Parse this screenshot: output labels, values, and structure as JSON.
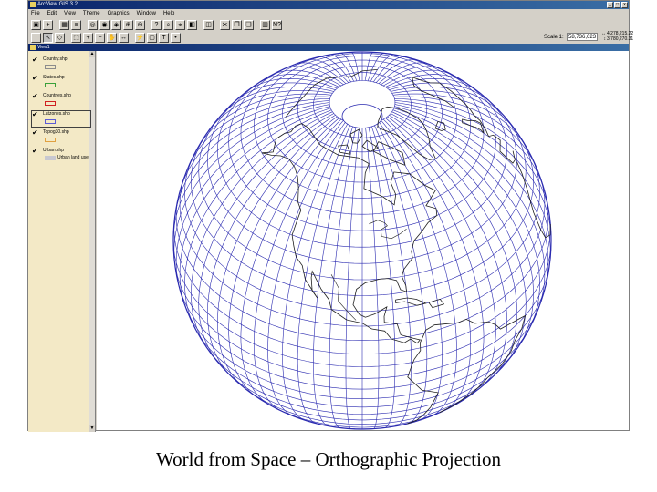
{
  "window": {
    "title": "ArcView GIS 3.2",
    "controls": [
      "_",
      "□",
      "x"
    ]
  },
  "menu": [
    "File",
    "Edit",
    "View",
    "Theme",
    "Graphics",
    "Window",
    "Help"
  ],
  "toolbar": {
    "row1_icons": [
      "save-icon",
      "add-theme-icon",
      "table-icon",
      "legend-icon",
      "zoom-full-icon",
      "zoom-active-icon",
      "zoom-selected-icon",
      "zoom-in-icon",
      "zoom-out-icon",
      "query-icon",
      "find-icon",
      "locate-icon",
      "select-by-theme-icon",
      "clear-selection-icon",
      "cut-icon",
      "copy-icon",
      "paste-icon",
      "chart-icon",
      "help-icon"
    ],
    "row2_icons": [
      "identify-icon",
      "pointer-icon",
      "vertex-icon",
      "select-icon",
      "zoom-in-tool-icon",
      "zoom-out-tool-icon",
      "pan-icon",
      "measure-icon",
      "hotlink-icon",
      "area-icon",
      "text-icon",
      "draw-icon"
    ],
    "scale_label": "Scale 1:",
    "scale_value": "58,736,623",
    "coords": [
      "4,278,215.22",
      "3,780,270.31"
    ]
  },
  "view": {
    "title": "View1",
    "layers": [
      {
        "name": "Country.shp",
        "color": "#8c8c8c",
        "active": false,
        "legend": ""
      },
      {
        "name": "States.shp",
        "color": "#3aa03a",
        "active": false,
        "legend": ""
      },
      {
        "name": "Countries.shp",
        "color": "#d02020",
        "active": false,
        "legend": ""
      },
      {
        "name": "Latzones.shp",
        "color": "#5b5bd6",
        "active": true,
        "legend": ""
      },
      {
        "name": "Topog30.shp",
        "color": "#e0a040",
        "active": false,
        "legend": ""
      },
      {
        "name": "Urban.shp",
        "color": "#c8c8d0",
        "active": false,
        "legend": "Urban land use"
      }
    ]
  },
  "map": {
    "graticule_color": "#2a2ab0",
    "coast_color": "#202020",
    "projection_center_lat": 42,
    "projection_center_lon": -95
  },
  "caption": "World from Space – Orthographic Projection"
}
